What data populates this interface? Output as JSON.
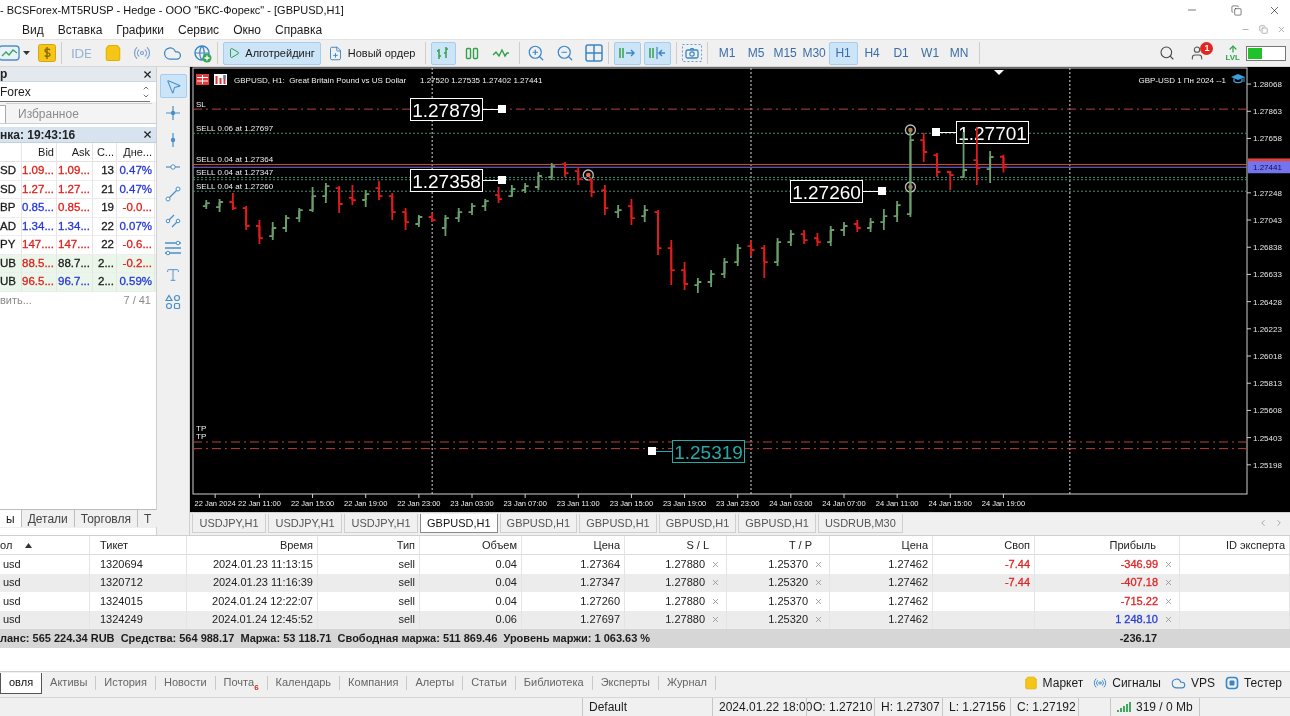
{
  "window": {
    "title": "- BCSForex-MT5RUSP - Hedge - ООО \"БКС-Форекс\" - [GBPUSD,H1]"
  },
  "menu": [
    {
      "label": "Вид"
    },
    {
      "label": "Вставка"
    },
    {
      "label": "Графики"
    },
    {
      "label": "Сервис"
    },
    {
      "label": "Окно"
    },
    {
      "label": "Справка"
    }
  ],
  "toolbar": {
    "ide": {
      "label": "IDE"
    },
    "algo_trading": {
      "label": "Алготрейдинг",
      "on": true
    },
    "new_order": {
      "label": "Новый ордер"
    },
    "chart_types": [
      {
        "kind": "bars",
        "selected": true
      },
      {
        "kind": "candles",
        "selected": false
      },
      {
        "kind": "line",
        "selected": false
      }
    ],
    "autoscroll": {
      "on": true
    },
    "chart_shift": {
      "on": true
    },
    "timeframes": [
      {
        "label": "M1",
        "selected": false
      },
      {
        "label": "M5",
        "selected": false
      },
      {
        "label": "M15",
        "selected": false
      },
      {
        "label": "M30",
        "selected": false
      },
      {
        "label": "H1",
        "selected": true
      },
      {
        "label": "H4",
        "selected": false
      },
      {
        "label": "D1",
        "selected": false
      },
      {
        "label": "W1",
        "selected": false
      },
      {
        "label": "MN",
        "selected": false
      }
    ],
    "notifications": {
      "badge": "1"
    },
    "level": {
      "label": "LVL"
    }
  },
  "top_panel": {
    "title": "р",
    "dropdown": "Forex",
    "tab": {
      "label": "Избранное",
      "selected": false
    }
  },
  "market_watch": {
    "title": "нка: 19:43:16",
    "columns": [
      "",
      "Bid",
      "Ask",
      "С...",
      "Дне..."
    ],
    "rows": [
      {
        "highlighted": false,
        "cells": [
          {
            "text": "SD"
          },
          {
            "text": "1.09...",
            "color": "#e0201c"
          },
          {
            "text": "1.09...",
            "color": "#e0201c"
          },
          {
            "text": "13"
          },
          {
            "text": "0.47%",
            "color": "#2637d8"
          }
        ]
      },
      {
        "highlighted": false,
        "cells": [
          {
            "text": "SD"
          },
          {
            "text": "1.27...",
            "color": "#e0201c"
          },
          {
            "text": "1.27...",
            "color": "#e0201c"
          },
          {
            "text": "21"
          },
          {
            "text": "0.47%",
            "color": "#2637d8"
          }
        ]
      },
      {
        "highlighted": false,
        "cells": [
          {
            "text": "BP"
          },
          {
            "text": "0.85...",
            "color": "#2637d8"
          },
          {
            "text": "0.85...",
            "color": "#e0201c"
          },
          {
            "text": "19"
          },
          {
            "text": "-0.0...",
            "color": "#e0201c"
          }
        ]
      },
      {
        "highlighted": false,
        "cells": [
          {
            "text": "AD"
          },
          {
            "text": "1.34...",
            "color": "#2637d8"
          },
          {
            "text": "1.34...",
            "color": "#2637d8"
          },
          {
            "text": "22"
          },
          {
            "text": "0.07%",
            "color": "#2637d8"
          }
        ]
      },
      {
        "highlighted": false,
        "cells": [
          {
            "text": "PY"
          },
          {
            "text": "147....",
            "color": "#e0201c"
          },
          {
            "text": "147....",
            "color": "#e0201c"
          },
          {
            "text": "22"
          },
          {
            "text": "-0.6...",
            "color": "#e0201c"
          }
        ]
      },
      {
        "highlighted": true,
        "cells": [
          {
            "text": "UB"
          },
          {
            "text": "88.5...",
            "color": "#e0201c"
          },
          {
            "text": "88.7...",
            "color": "#1b1b1b"
          },
          {
            "text": "2..."
          },
          {
            "text": "-0.2...",
            "color": "#e0201c"
          }
        ]
      },
      {
        "highlighted": true,
        "cells": [
          {
            "text": "UB"
          },
          {
            "text": "96.5...",
            "color": "#e0201c"
          },
          {
            "text": "96.7...",
            "color": "#2637d8"
          },
          {
            "text": "2..."
          },
          {
            "text": "0.59%",
            "color": "#2637d8"
          }
        ]
      }
    ],
    "footer": {
      "left": "вить...",
      "count": "7 / 41"
    }
  },
  "left_tabs": [
    {
      "label": "ы",
      "selected": true
    },
    {
      "label": "Детали",
      "selected": false
    },
    {
      "label": "Торговля",
      "selected": false
    },
    {
      "label": "Т",
      "selected": false
    }
  ],
  "drawing_tools": [
    {
      "kind": "cursor",
      "selected": true
    },
    {
      "kind": "crosshair",
      "selected": false
    },
    {
      "kind": "vline",
      "selected": false
    },
    {
      "kind": "hline",
      "selected": false
    },
    {
      "kind": "trendline",
      "selected": false
    },
    {
      "kind": "channel",
      "selected": false
    },
    {
      "kind": "levels",
      "selected": false
    },
    {
      "kind": "text",
      "selected": false
    },
    {
      "kind": "shapes",
      "selected": false
    }
  ],
  "chart": {
    "chart_data": {
      "type": "candlestick",
      "marker": "bar",
      "title": "GBPUSD, H1:  Great Britain Pound vs US Dollar",
      "subtitle": "1.27520 1.27535 1.27402 1.27441",
      "annotations": [
        "GBP-USD 1 Пн 2024 --1"
      ],
      "x": [
        "2024-01-22T07:00",
        "2024-01-22T08:00",
        "2024-01-22T09:00",
        "2024-01-22T10:00",
        "2024-01-22T11:00",
        "2024-01-22T12:00",
        "2024-01-22T13:00",
        "2024-01-22T14:00",
        "2024-01-22T15:00",
        "2024-01-22T16:00",
        "2024-01-22T17:00",
        "2024-01-22T18:00",
        "2024-01-22T19:00",
        "2024-01-22T20:00",
        "2024-01-22T21:00",
        "2024-01-22T22:00",
        "2024-01-22T23:00",
        "2024-01-23T00:00",
        "2024-01-23T01:00",
        "2024-01-23T02:00",
        "2024-01-23T03:00",
        "2024-01-23T04:00",
        "2024-01-23T05:00",
        "2024-01-23T06:00",
        "2024-01-23T07:00",
        "2024-01-23T08:00",
        "2024-01-23T09:00",
        "2024-01-23T10:00",
        "2024-01-23T11:00",
        "2024-01-23T12:00",
        "2024-01-23T13:00",
        "2024-01-23T14:00",
        "2024-01-23T15:00",
        "2024-01-23T16:00",
        "2024-01-23T17:00",
        "2024-01-23T18:00",
        "2024-01-23T19:00",
        "2024-01-23T20:00",
        "2024-01-23T21:00",
        "2024-01-23T22:00",
        "2024-01-23T23:00",
        "2024-01-24T00:00",
        "2024-01-24T01:00",
        "2024-01-24T02:00",
        "2024-01-24T03:00",
        "2024-01-24T04:00",
        "2024-01-24T05:00",
        "2024-01-24T06:00",
        "2024-01-24T07:00",
        "2024-01-24T08:00",
        "2024-01-24T09:00",
        "2024-01-24T10:00",
        "2024-01-24T11:00",
        "2024-01-24T12:00",
        "2024-01-24T13:00",
        "2024-01-24T14:00",
        "2024-01-24T15:00",
        "2024-01-24T16:00",
        "2024-01-24T17:00",
        "2024-01-24T18:00",
        "2024-01-24T19:00"
      ],
      "ohlc": [
        [
          1.27148,
          1.27194,
          1.27126,
          1.27171
        ],
        [
          1.27141,
          1.27201,
          1.27103,
          1.27179
        ],
        [
          1.27179,
          1.27246,
          1.27118,
          1.27133
        ],
        [
          1.27133,
          1.27148,
          1.26968,
          1.26998
        ],
        [
          1.26998,
          1.27043,
          1.26862,
          1.26907
        ],
        [
          1.26922,
          1.27028,
          1.26892,
          1.26983
        ],
        [
          1.26983,
          1.27081,
          1.26953,
          1.27058
        ],
        [
          1.27058,
          1.27133,
          1.27028,
          1.27118
        ],
        [
          1.27118,
          1.27292,
          1.27103,
          1.27224
        ],
        [
          1.27224,
          1.27322,
          1.27171,
          1.27299
        ],
        [
          1.27284,
          1.27299,
          1.27096,
          1.27164
        ],
        [
          1.2721,
          1.27307,
          1.27156,
          1.27192
        ],
        [
          1.27194,
          1.27269,
          1.27141,
          1.27239
        ],
        [
          1.27284,
          1.27337,
          1.27194,
          1.27224
        ],
        [
          1.27224,
          1.27246,
          1.27043,
          1.27103
        ],
        [
          1.27103,
          1.27133,
          1.26968,
          1.27028
        ],
        [
          1.27013,
          1.27081,
          1.2699,
          1.27066
        ],
        [
          1.27066,
          1.27096,
          1.27028,
          1.27043
        ],
        [
          1.26983,
          1.27081,
          1.26922,
          1.27058
        ],
        [
          1.27058,
          1.27133,
          1.27028,
          1.27103
        ],
        [
          1.27103,
          1.27171,
          1.27081,
          1.27148
        ],
        [
          1.27148,
          1.27201,
          1.27111,
          1.27186
        ],
        [
          1.27231,
          1.27292,
          1.27171,
          1.27201
        ],
        [
          1.27224,
          1.27307,
          1.27216,
          1.27277
        ],
        [
          1.27269,
          1.27322,
          1.27246,
          1.27299
        ],
        [
          1.27292,
          1.27405,
          1.27269,
          1.27375
        ],
        [
          1.27367,
          1.27473,
          1.27344,
          1.2745
        ],
        [
          1.27465,
          1.2748,
          1.27367,
          1.27397
        ],
        [
          1.27412,
          1.27442,
          1.27307,
          1.27352
        ],
        [
          1.27344,
          1.2736,
          1.27216,
          1.27254
        ],
        [
          1.27269,
          1.27307,
          1.27081,
          1.27133
        ],
        [
          1.27103,
          1.27156,
          1.27058,
          1.27118
        ],
        [
          1.27148,
          1.27201,
          1.27005,
          1.27058
        ],
        [
          1.27073,
          1.27156,
          1.27028,
          1.27118
        ],
        [
          1.27103,
          1.27118,
          1.26779,
          1.26832
        ],
        [
          1.26832,
          1.26892,
          1.26553,
          1.26666
        ],
        [
          1.26666,
          1.26726,
          1.26515,
          1.26561
        ],
        [
          1.26553,
          1.26606,
          1.26493,
          1.26576
        ],
        [
          1.26576,
          1.26666,
          1.26538,
          1.26636
        ],
        [
          1.26636,
          1.26757,
          1.26606,
          1.26726
        ],
        [
          1.26726,
          1.26862,
          1.26696,
          1.26832
        ],
        [
          1.26847,
          1.26892,
          1.26772,
          1.26817
        ],
        [
          1.26832,
          1.26855,
          1.26606,
          1.26726
        ],
        [
          1.26726,
          1.26907,
          1.26696,
          1.26877
        ],
        [
          1.26877,
          1.26968,
          1.26847,
          1.26937
        ],
        [
          1.26937,
          1.26968,
          1.26862,
          1.26892
        ],
        [
          1.26907,
          1.26945,
          1.26847,
          1.26877
        ],
        [
          1.26877,
          1.26998,
          1.26847,
          1.26968
        ],
        [
          1.26968,
          1.27028,
          1.26922,
          1.26998
        ],
        [
          1.27013,
          1.27043,
          1.26953,
          1.26983
        ],
        [
          1.26983,
          1.27058,
          1.26953,
          1.27028
        ],
        [
          1.27028,
          1.27126,
          1.26968,
          1.27073
        ],
        [
          1.27073,
          1.27186,
          1.27028,
          1.27156
        ],
        [
          1.27088,
          1.27736,
          1.27066,
          1.27646
        ],
        [
          1.27646,
          1.27699,
          1.2748,
          1.27556
        ],
        [
          1.27533,
          1.27548,
          1.27367,
          1.27405
        ],
        [
          1.27405,
          1.27412,
          1.27269,
          1.27382
        ],
        [
          1.27367,
          1.27706,
          1.2736,
          1.2742
        ],
        [
          1.27495,
          1.27744,
          1.27307,
          1.27435
        ],
        [
          1.27427,
          1.27563,
          1.27322,
          1.27518
        ],
        [
          1.2752,
          1.27535,
          1.27402,
          1.27441
        ]
      ],
      "colors": [
        "#6a9e6a",
        "#6a9e6a",
        "#e01b1b",
        "#e01b1b",
        "#e01b1b",
        "#6a9e6a",
        "#6a9e6a",
        "#6a9e6a",
        "#6a9e6a",
        "#6a9e6a",
        "#e01b1b",
        "#e01b1b",
        "#6a9e6a",
        "#e01b1b",
        "#e01b1b",
        "#e01b1b",
        "#6a9e6a",
        "#e01b1b",
        "#6a9e6a",
        "#6a9e6a",
        "#6a9e6a",
        "#6a9e6a",
        "#e01b1b",
        "#6a9e6a",
        "#6a9e6a",
        "#6a9e6a",
        "#6a9e6a",
        "#e01b1b",
        "#e01b1b",
        "#e01b1b",
        "#e01b1b",
        "#6a9e6a",
        "#e01b1b",
        "#6a9e6a",
        "#e01b1b",
        "#e01b1b",
        "#e01b1b",
        "#6a9e6a",
        "#6a9e6a",
        "#6a9e6a",
        "#6a9e6a",
        "#e01b1b",
        "#e01b1b",
        "#6a9e6a",
        "#6a9e6a",
        "#e01b1b",
        "#e01b1b",
        "#6a9e6a",
        "#6a9e6a",
        "#e01b1b",
        "#6a9e6a",
        "#6a9e6a",
        "#6a9e6a",
        "#6a9e6a",
        "#e01b1b",
        "#e01b1b",
        "#e01b1b",
        "#6a9e6a",
        "#e01b1b",
        "#6a9e6a",
        "#e01b1b"
      ],
      "xlim": [
        "2024-01-22T06:00",
        "2024-01-25T13:20"
      ],
      "ylim": [
        1.24978,
        1.28189
      ],
      "xticks": [
        {
          "value": "2024-01-22T07:40",
          "label": "22 Jan 2024"
        },
        {
          "value": "2024-01-22T11:00",
          "label": "22 Jan 11:00"
        },
        {
          "value": "2024-01-22T15:00",
          "label": "22 Jan 15:00"
        },
        {
          "value": "2024-01-22T19:00",
          "label": "22 Jan 19:00"
        },
        {
          "value": "2024-01-22T23:00",
          "label": "22 Jan 23:00"
        },
        {
          "value": "2024-01-23T03:00",
          "label": "23 Jan 03:00"
        },
        {
          "value": "2024-01-23T07:00",
          "label": "23 Jan 07:00"
        },
        {
          "value": "2024-01-23T11:00",
          "label": "23 Jan 11:00"
        },
        {
          "value": "2024-01-23T15:00",
          "label": "23 Jan 15:00"
        },
        {
          "value": "2024-01-23T19:00",
          "label": "23 Jan 19:00"
        },
        {
          "value": "2024-01-23T23:00",
          "label": "23 Jan 23:00"
        },
        {
          "value": "2024-01-24T03:00",
          "label": "24 Jan 03:00"
        },
        {
          "value": "2024-01-24T07:00",
          "label": "24 Jan 07:00"
        },
        {
          "value": "2024-01-24T11:00",
          "label": "24 Jan 11:00"
        },
        {
          "value": "2024-01-24T15:00",
          "label": "24 Jan 15:00"
        },
        {
          "value": "2024-01-24T19:00",
          "label": "24 Jan 19:00"
        }
      ],
      "yticks": [
        1.28068,
        1.27863,
        1.27658,
        1.27248,
        1.27043,
        1.26838,
        1.26633,
        1.26428,
        1.26223,
        1.26018,
        1.25813,
        1.25608,
        1.25403,
        1.25198
      ],
      "ref_lines": [
        {
          "axis": "y",
          "value": 1.27879,
          "label": "SL",
          "color": "#b5443a",
          "line_style": "dashdot"
        },
        {
          "axis": "y",
          "value": 1.27697,
          "label": "SELL 0.06 at 1.27697",
          "color": "#3f8f73",
          "line_style": "dotted"
        },
        {
          "axis": "y",
          "value": 1.27462,
          "color": "#e0463c",
          "line_style": "solid"
        },
        {
          "axis": "y",
          "value": 1.27441,
          "label": "1.27441",
          "color": "#7474ee",
          "line_style": "solid"
        },
        {
          "axis": "y",
          "value": 1.27364,
          "label": "SELL 0.04 at 1.27364",
          "color": "#3f8f73",
          "line_style": "dotted"
        },
        {
          "axis": "y",
          "value": 1.27347,
          "label": "SELL 0.04 at 1.27347",
          "color": "#3f8f73",
          "line_style": "dotted"
        },
        {
          "axis": "y",
          "value": 1.2726,
          "label": "SELL 0.04 at 1.27260",
          "color": "#3f8f73",
          "line_style": "dotted"
        },
        {
          "axis": "y",
          "value": 1.2537,
          "label": "TP",
          "color": "#b5443a",
          "line_style": "dashdot"
        },
        {
          "axis": "y",
          "value": 1.2532,
          "label": "TP",
          "color": "#b5443a",
          "line_style": "dashdot"
        },
        {
          "axis": "x",
          "value": "2024-01-23T00:00",
          "color": "#d8d8d8",
          "line_style": "dotted"
        },
        {
          "axis": "x",
          "value": "2024-01-24T00:00",
          "color": "#d8d8d8",
          "line_style": "dotted"
        },
        {
          "axis": "x",
          "value": "2024-01-25T00:00",
          "color": "#d8d8d8",
          "line_style": "dotted"
        }
      ]
    },
    "price_tags": [
      {
        "label": "1.27879",
        "color": "#ffffff"
      },
      {
        "label": "1.27358",
        "color": "#ffffff"
      },
      {
        "label": "1.27260",
        "color": "#ffffff"
      },
      {
        "label": "1.27701",
        "color": "#ffffff"
      },
      {
        "label": "1.25319",
        "color": "#2aa8a8"
      }
    ]
  },
  "chart_tabs": [
    {
      "label": "USDJPY,H1",
      "selected": false
    },
    {
      "label": "USDJPY,H1",
      "selected": false
    },
    {
      "label": "USDJPY,H1",
      "selected": false
    },
    {
      "label": "GBPUSD,H1",
      "selected": true
    },
    {
      "label": "GBPUSD,H1",
      "selected": false
    },
    {
      "label": "GBPUSD,H1",
      "selected": false
    },
    {
      "label": "GBPUSD,H1",
      "selected": false
    },
    {
      "label": "GBPUSD,H1",
      "selected": false
    },
    {
      "label": "USDRUB,M30",
      "selected": false
    }
  ],
  "trade_table": {
    "columns": [
      {
        "label": "ол",
        "sorted": true
      },
      {
        "label": "Тикет",
        "sorted": false
      },
      {
        "label": "Время",
        "sorted": false
      },
      {
        "label": "Тип",
        "sorted": false
      },
      {
        "label": "Объем",
        "sorted": false
      },
      {
        "label": "Цена",
        "sorted": false
      },
      {
        "label": "S / L",
        "sorted": false
      },
      {
        "label": "T / P",
        "sorted": false
      },
      {
        "label": "Цена",
        "sorted": false
      },
      {
        "label": "Своп",
        "sorted": false
      },
      {
        "label": "Прибыль",
        "sorted": false
      },
      {
        "label": "ID эксперта",
        "sorted": false
      }
    ],
    "rows": [
      {
        "column_1": "usd",
        "ticket": "1320694",
        "time": "2024.01.23 11:13:15",
        "type": "sell",
        "volume": "0.04",
        "price": "1.27364",
        "sl": "1.27880",
        "tp": "1.25370",
        "current_price": "1.27462",
        "swap": {
          "text": "-7.44",
          "color": "#e02424"
        },
        "profit": {
          "text": "-346.99",
          "color": "#e02424"
        }
      },
      {
        "column_1": "usd",
        "ticket": "1320712",
        "time": "2024.01.23 11:16:39",
        "type": "sell",
        "volume": "0.04",
        "price": "1.27347",
        "sl": "1.27880",
        "tp": "1.25320",
        "current_price": "1.27462",
        "swap": {
          "text": "-7.44",
          "color": "#e02424"
        },
        "profit": {
          "text": "-407.18",
          "color": "#e02424"
        }
      },
      {
        "column_1": "usd",
        "ticket": "1324015",
        "time": "2024.01.24 12:22:07",
        "type": "sell",
        "volume": "0.04",
        "price": "1.27260",
        "sl": "1.27880",
        "tp": "1.25370",
        "current_price": "1.27462",
        "profit": {
          "text": "-715.22",
          "color": "#e02424"
        }
      },
      {
        "column_1": "usd",
        "ticket": "1324249",
        "time": "2024.01.24 12:45:52",
        "type": "sell",
        "volume": "0.06",
        "price": "1.27697",
        "sl": "1.27880",
        "tp": "1.25320",
        "current_price": "1.27462",
        "profit": {
          "text": "1 248.10",
          "color": "#2a3fd6"
        }
      }
    ],
    "summary": {
      "text": "ланс: 565 224.34 RUB  Средства: 564 988.17  Маржа: 53 118.71  Свободная маржа: 511 869.46  Уровень маржи: 1 063.63 %",
      "total": "-236.17"
    }
  },
  "bottom_tabs": [
    {
      "label": "овля",
      "selected": true
    },
    {
      "label": "Активы",
      "selected": false
    },
    {
      "label": "История",
      "selected": false
    },
    {
      "label": "Новости",
      "selected": false
    },
    {
      "label": "Почта",
      "badge": "6",
      "selected": false
    },
    {
      "label": "Календарь",
      "selected": false
    },
    {
      "label": "Компания",
      "selected": false
    },
    {
      "label": "Алерты",
      "selected": false
    },
    {
      "label": "Статьи",
      "selected": false
    },
    {
      "label": "Библиотека",
      "selected": false
    },
    {
      "label": "Эксперты",
      "selected": false
    },
    {
      "label": "Журнал",
      "selected": false
    }
  ],
  "bottom_links": [
    {
      "kind": "market",
      "label": "Маркет"
    },
    {
      "kind": "signals",
      "label": "Сигналы"
    },
    {
      "kind": "vps",
      "label": "VPS"
    },
    {
      "kind": "tester",
      "label": "Тестер"
    }
  ],
  "status_bar": {
    "profile": "Default",
    "time": "2024.01.22 18:00",
    "values": [
      "O: 1.27210",
      "H: 1.27307",
      "L: 1.27156",
      "C: 1.27192"
    ],
    "memory": "319 / 0 Mb"
  }
}
